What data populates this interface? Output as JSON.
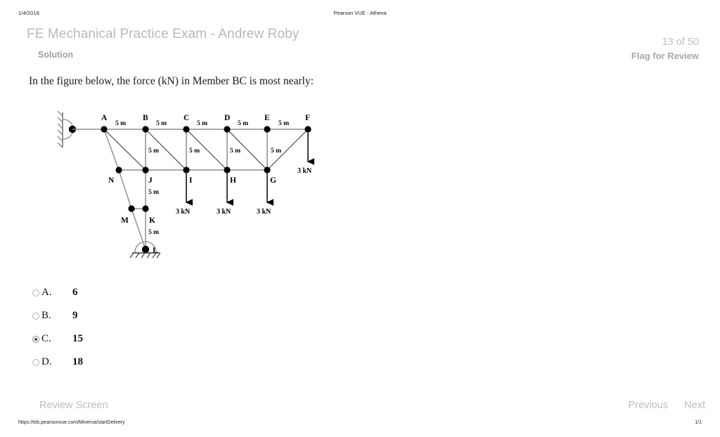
{
  "browser_print": {
    "date": "1/4/2016",
    "page_title": "Pearson VUE - Athena",
    "url": "https://tds.pearsonvue.com/Minerva/startDelivery",
    "page_number": "1/1"
  },
  "header": {
    "exam_title": "FE Mechanical Practice Exam - Andrew Roby",
    "solution_label": "Solution",
    "question_counter": "13 of 50",
    "flag_for_review": "Flag for Review"
  },
  "question": {
    "stem": "In the figure below, the force (kN) in Member BC is most nearly:",
    "options": [
      {
        "letter": "A.",
        "value": "6",
        "selected": false
      },
      {
        "letter": "B.",
        "value": "9",
        "selected": false
      },
      {
        "letter": "C.",
        "value": "15",
        "selected": true
      },
      {
        "letter": "D.",
        "value": "18",
        "selected": false
      }
    ]
  },
  "figure": {
    "description": "Cantilever truss diagram with pin support at left wall and roller support at base",
    "top_nodes": [
      "A",
      "B",
      "C",
      "D",
      "E",
      "F"
    ],
    "middle_nodes": [
      "N",
      "J",
      "I",
      "H",
      "G"
    ],
    "lower_nodes": [
      "M",
      "K",
      "L"
    ],
    "top_spans": [
      "5 m",
      "5 m",
      "5 m",
      "5 m",
      "5 m"
    ],
    "vertical_dims": [
      "5 m",
      "5 m",
      "5 m",
      "5 m",
      "5 m",
      "5 m"
    ],
    "loads": [
      {
        "node": "I",
        "label": "3 kN"
      },
      {
        "node": "H",
        "label": "3 kN"
      },
      {
        "node": "G",
        "label": "3 kN"
      },
      {
        "node": "F",
        "label": "3 kN"
      }
    ],
    "labels": {
      "A": "A",
      "B": "B",
      "C": "C",
      "D": "D",
      "E": "E",
      "F": "F",
      "G": "G",
      "H": "H",
      "I": "I",
      "J": "J",
      "K": "K",
      "L": "L",
      "M": "M",
      "N": "N"
    }
  },
  "footer": {
    "review_screen": "Review Screen",
    "previous": "Previous",
    "next": "Next"
  }
}
